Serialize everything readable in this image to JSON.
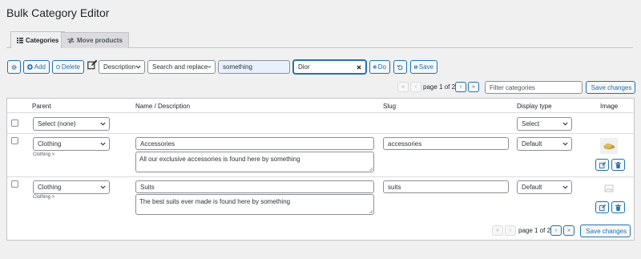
{
  "page": {
    "title": "Bulk Category Editor"
  },
  "tabs": [
    {
      "label": "Categories",
      "active": true
    },
    {
      "label": "Move products",
      "active": false
    }
  ],
  "toolbar": {
    "add_label": "Add",
    "delete_label": "Delete",
    "field_select": "Description",
    "action_select": "Search and replace",
    "search_value": "something",
    "replace_value": "Dior",
    "do_label": "Do",
    "save_label": "Save"
  },
  "pagination": {
    "page_text": "page 1 of 2",
    "filter_placeholder": "Filter categories",
    "save_changes_label": "Save changes"
  },
  "table": {
    "columns": {
      "parent": "Parent",
      "name": "Name / Description",
      "slug": "Slug",
      "display_type": "Display type",
      "image": "Image"
    },
    "bulk_row": {
      "parent_select": "Select (none)",
      "display_select": "Select"
    },
    "rows": [
      {
        "parent": "Clothing",
        "parent_path": "Clothing >",
        "name": "Accessories",
        "description": "All our exclusive accessories is found here by something",
        "slug": "accessories",
        "display_type": "Default"
      },
      {
        "parent": "Clothing",
        "parent_path": "Clothing >",
        "name": "Suits",
        "description": "The best suits ever made is found here by something",
        "slug": "suits",
        "display_type": "Default"
      }
    ]
  },
  "colors": {
    "accent": "#2271b1",
    "border": "#c3c4c7",
    "background": "#f0f0f1"
  }
}
